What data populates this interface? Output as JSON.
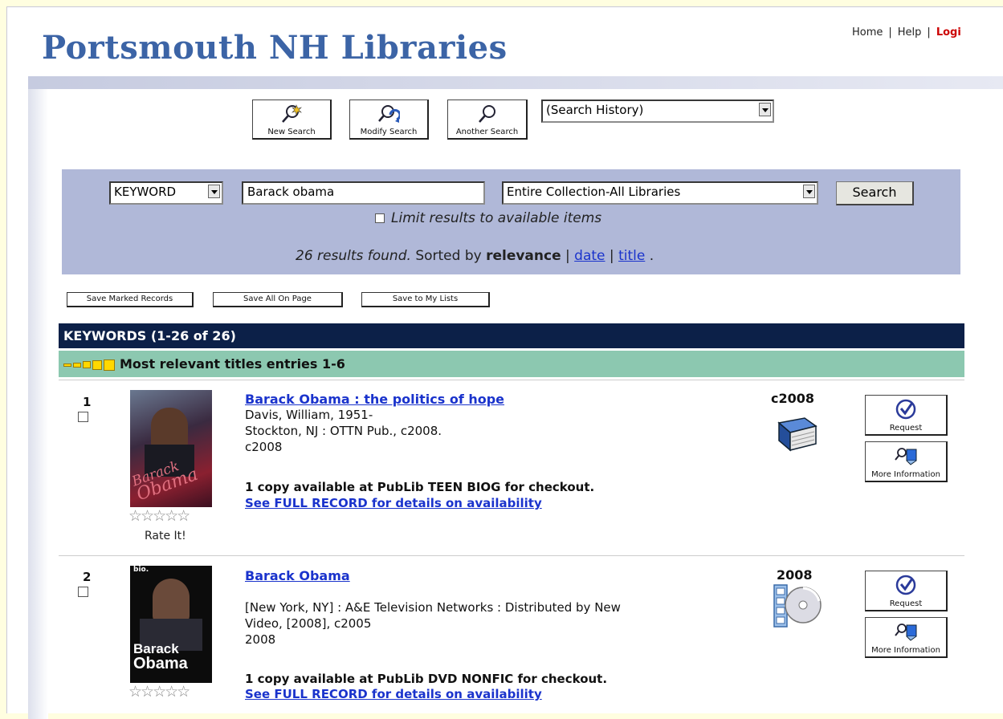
{
  "header": {
    "site_title": "Portsmouth NH Libraries",
    "links": {
      "home": "Home",
      "help": "Help",
      "login": "Logi"
    }
  },
  "toolbar": {
    "new_search": "New Search",
    "modify_search": "Modify Search",
    "another_search": "Another Search",
    "search_history": "(Search History)"
  },
  "search": {
    "type": "KEYWORD",
    "query": "Barack obama",
    "scope": "Entire Collection-All Libraries",
    "button": "Search",
    "limit_label": "Limit results to available items",
    "results_count_text": "26 results found.",
    "sorted_by_label": "Sorted by",
    "sorted_by_value": "relevance",
    "sort_date": "date",
    "sort_title": "title",
    "sort_end": "."
  },
  "save": {
    "marked": "Save Marked Records",
    "all_on_page": "Save All On Page",
    "my_lists": "Save to My Lists"
  },
  "results": {
    "header": "KEYWORDS (1-26 of 26)",
    "relevance_header": "Most relevant titles entries 1-6",
    "records": [
      {
        "number": "1",
        "title": "Barack Obama : the politics of hope",
        "lines": [
          "Davis, William, 1951-",
          "Stockton, NJ : OTTN Pub., c2008.",
          "c2008"
        ],
        "availability": "1 copy available at PubLib TEEN BIOG for checkout.",
        "full_record": "See FULL RECORD for details on availability",
        "year": "c2008",
        "format_icon": "book-icon",
        "stars": "☆☆☆☆☆",
        "rate_it": "Rate It!",
        "request": "Request",
        "more_info": "More Information",
        "cover_text": [
          "Barack",
          "Obama"
        ]
      },
      {
        "number": "2",
        "title": "Barack Obama",
        "lines": [
          "[New York, NY] : A&E Television Networks : Distributed by New",
          "Video, [2008], c2005",
          "2008"
        ],
        "availability": "1 copy available at PubLib DVD NONFIC for checkout.",
        "full_record": "See FULL RECORD for details on availability",
        "year": "2008",
        "format_icon": "dvd-icon",
        "stars": "☆☆☆☆☆",
        "request": "Request",
        "more_info": "More Information",
        "cover_brand": "bio.",
        "cover_text": [
          "Barack",
          "Obama"
        ]
      }
    ]
  },
  "colors": {
    "title_blue": "#3c64a6",
    "link_blue": "#1a33cc",
    "dark_navy": "#0c2048",
    "relevance_green": "#8cc8b0",
    "search_panel": "#b0b8d8",
    "login_red": "#cc0000"
  }
}
